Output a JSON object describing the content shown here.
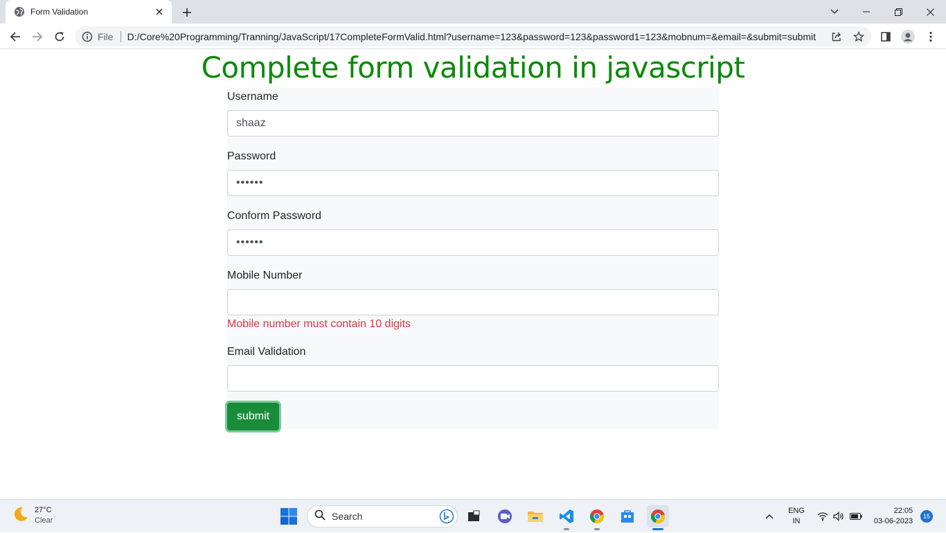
{
  "browser": {
    "tab_title": "Form Validation",
    "address_scheme": "File",
    "address_url": "D:/Core%20Programming/Tranning/JavaScript/17CompleteFormValid.html?username=123&password=123&password1=123&mobnum=&email=&submit=submit"
  },
  "page": {
    "heading": "Complete form validation in javascript",
    "heading_color": "#0a8a0a"
  },
  "form": {
    "username_label": "Username",
    "username_value": "shaaz",
    "password_label": "Password",
    "password_value": "••••••",
    "confirm_label": "Conform Password",
    "confirm_value": "••••••",
    "mobile_label": "Mobile Number",
    "mobile_value": "",
    "mobile_error": "Mobile number must contain 10 digits",
    "email_label": "Email Validation",
    "email_value": "",
    "submit_label": "submit",
    "error_color": "#dc3545",
    "submit_color": "#198c3a"
  },
  "taskbar": {
    "weather_temp": "27°C",
    "weather_condition": "Clear",
    "search_placeholder": "Search",
    "lang_primary": "ENG",
    "lang_secondary": "IN",
    "time": "22:05",
    "date": "03-06-2023",
    "notification_count": "15",
    "apps": [
      "file-explorer-dark-icon",
      "meet-icon",
      "folder-icon",
      "vscode-icon",
      "chrome-icon",
      "store-icon",
      "chrome-icon"
    ]
  }
}
